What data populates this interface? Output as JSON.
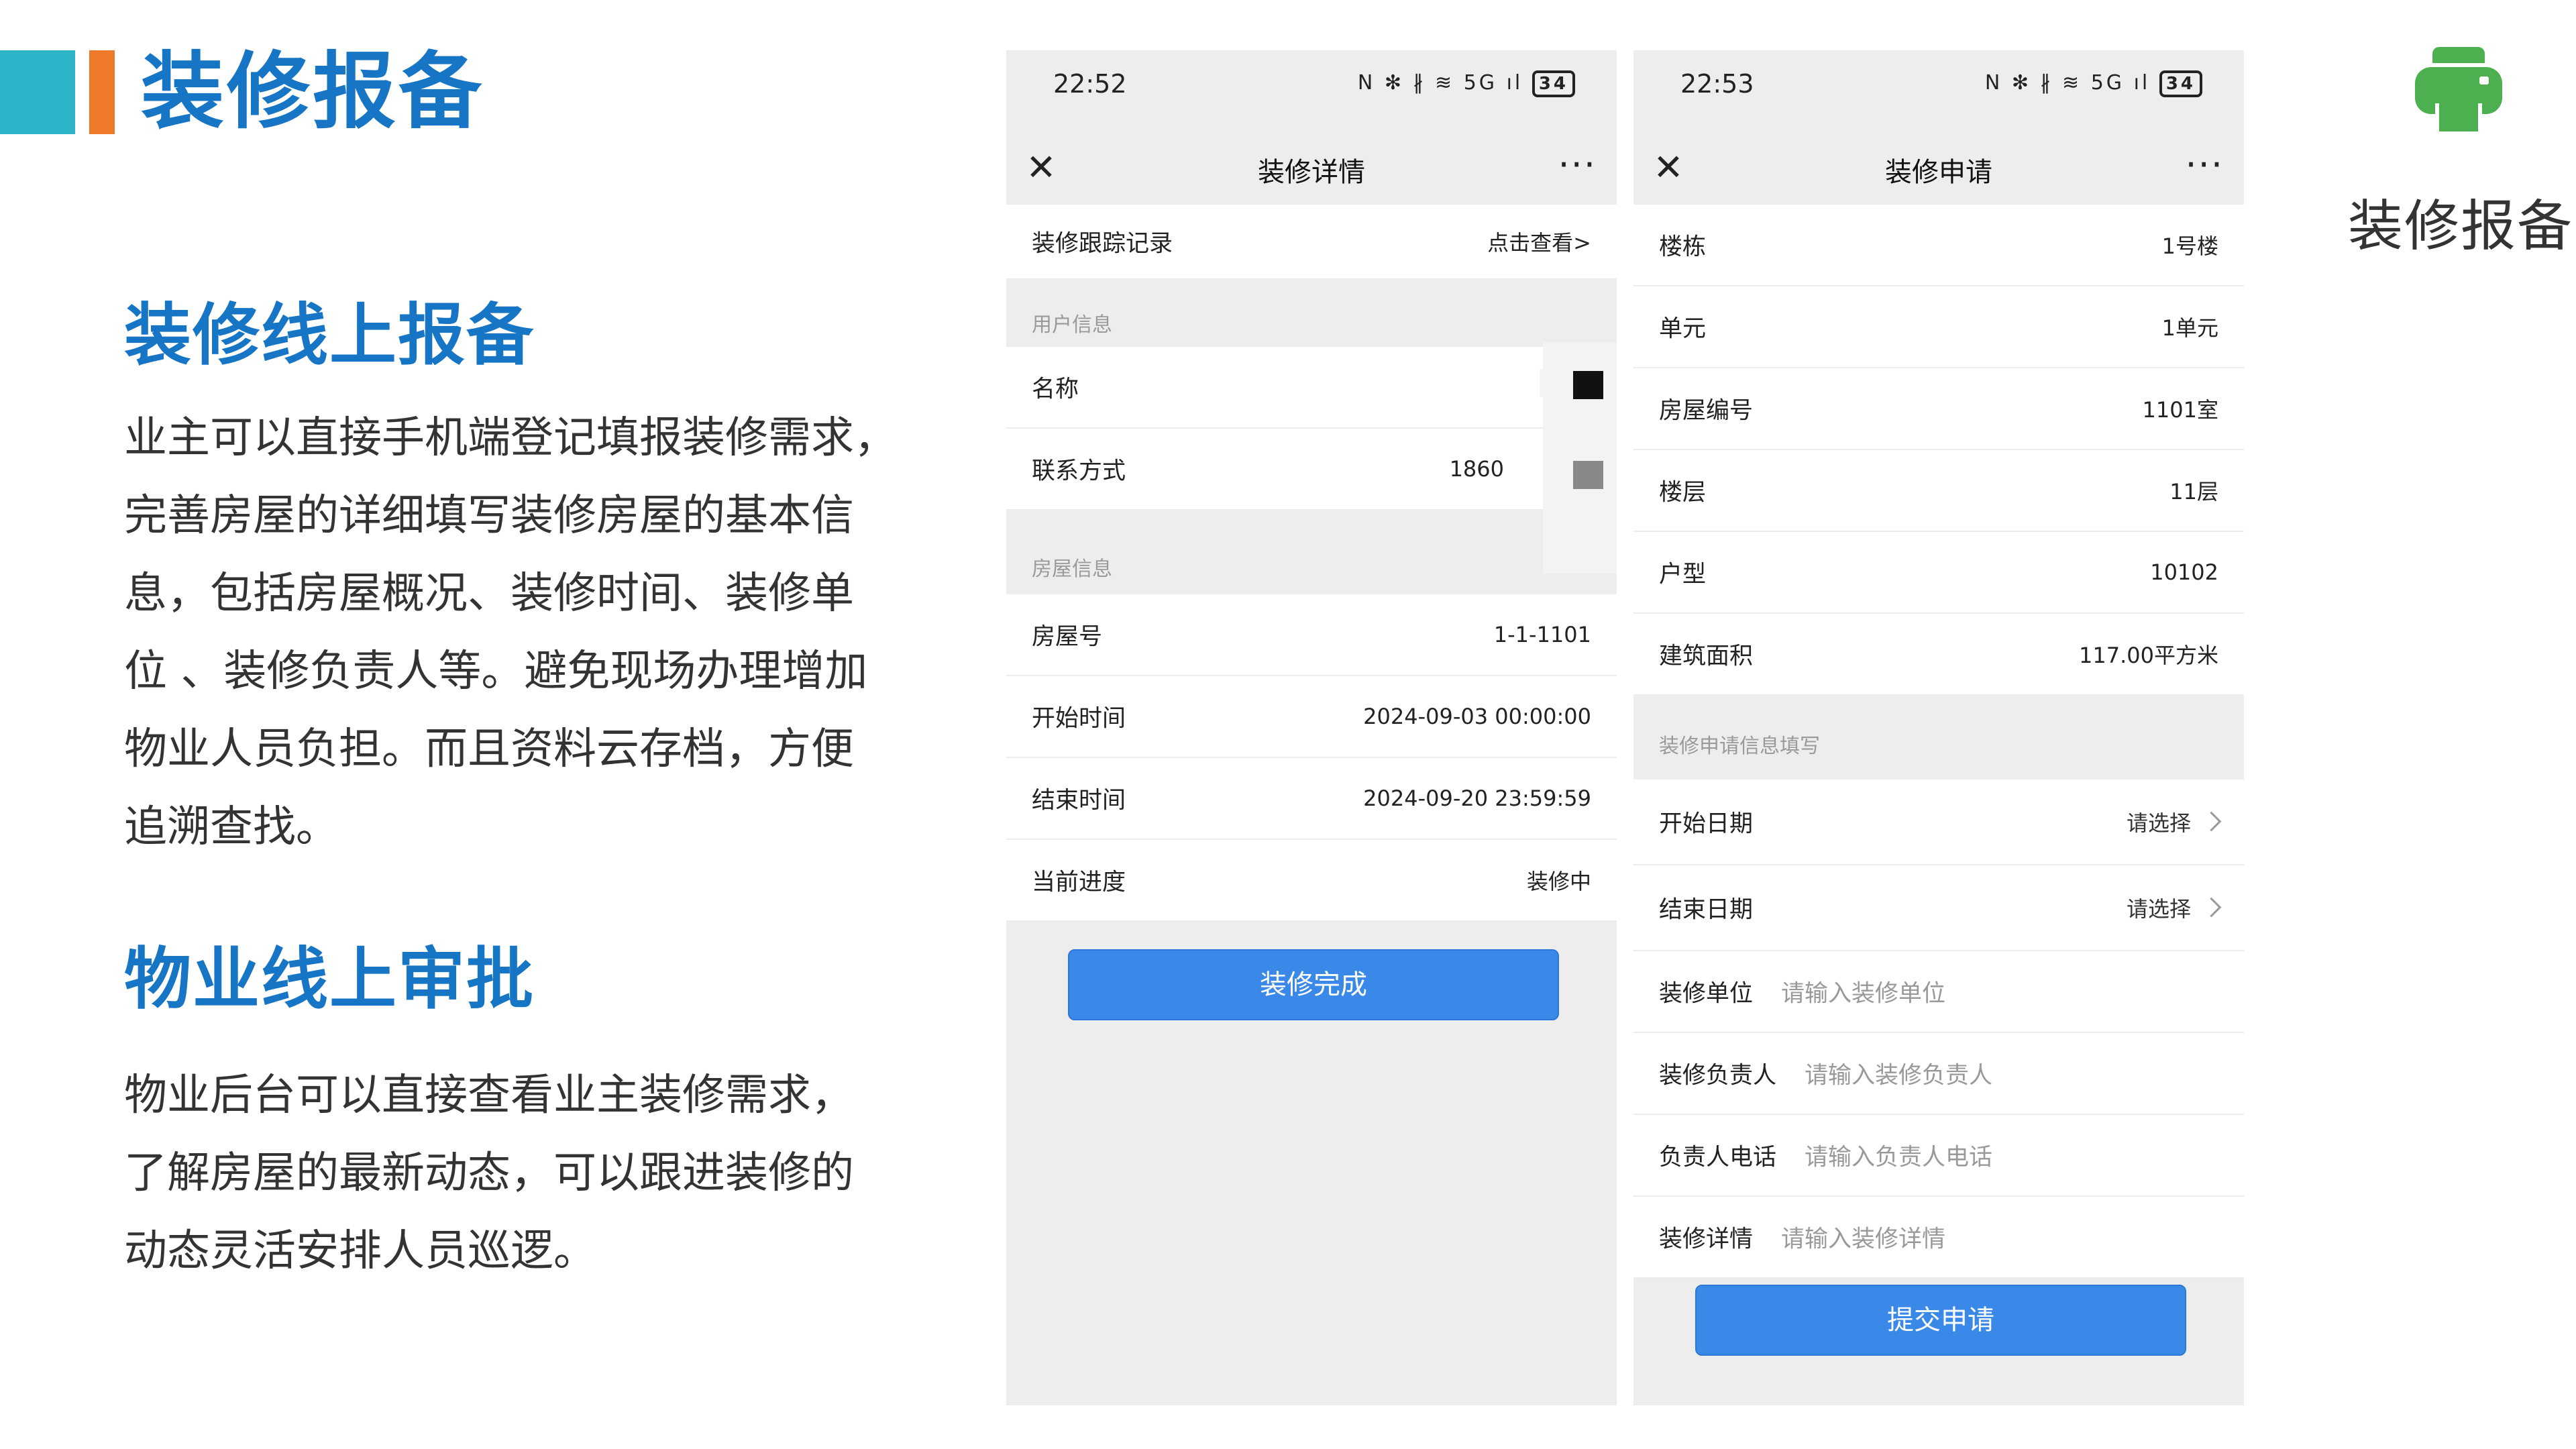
{
  "page_title": "装修报备",
  "section1": {
    "title": "装修线上报备",
    "lines": [
      "业主可以直接手机端登记填报装修需求，",
      "完善房屋的详细填写装修房屋的基本信",
      "息，包括房屋概况、装修时间、装修单",
      "位 、装修负责人等。避免现场办理增加",
      "物业人员负担。而且资料云存档，方便",
      "追溯查找。"
    ]
  },
  "section2": {
    "title": "物业线上审批",
    "lines": [
      "物业后台可以直接查看业主装修需求，",
      "了解房屋的最新动态，可以跟进装修的",
      "动态灵活安排人员巡逻。"
    ]
  },
  "phone1": {
    "status_time": "22:52",
    "status_icons": "N ✻ ∦ ≋ 5G ıl",
    "battery": "34",
    "nav_close": "✕",
    "nav_title": "装修详情",
    "nav_more": "···",
    "track_label": "装修跟踪记录",
    "track_value": "点击查看>",
    "group_user": "用户信息",
    "name_label": "名称",
    "contact_label": "联系方式",
    "contact_value": "1860",
    "group_house": "房屋信息",
    "house_no_label": "房屋号",
    "house_no_value": "1-1-1101",
    "start_label": "开始时间",
    "start_value": "2024-09-03 00:00:00",
    "end_label": "结束时间",
    "end_value": "2024-09-20 23:59:59",
    "progress_label": "当前进度",
    "progress_value": "装修中",
    "complete_button": "装修完成"
  },
  "phone2": {
    "status_time": "22:53",
    "status_icons": "N ✻ ∦ ≋ 5G ıl",
    "battery": "34",
    "nav_close": "✕",
    "nav_title": "装修申请",
    "nav_more": "···",
    "rows": [
      {
        "label": "楼栋",
        "value": "1号楼"
      },
      {
        "label": "单元",
        "value": "1单元"
      },
      {
        "label": "房屋编号",
        "value": "1101室"
      },
      {
        "label": "楼层",
        "value": "11层"
      },
      {
        "label": "户型",
        "value": "10102"
      },
      {
        "label": "建筑面积",
        "value": "117.00平方米"
      }
    ],
    "group_apply": "装修申请信息填写",
    "start_date_label": "开始日期",
    "end_date_label": "结束日期",
    "select_placeholder": "请选择",
    "unit_label": "装修单位",
    "unit_placeholder": "请输入装修单位",
    "manager_label": "装修负责人",
    "manager_placeholder": "请输入装修负责人",
    "phone_label": "负责人电话",
    "phone_placeholder": "请输入负责人电话",
    "detail_label": "装修详情",
    "detail_placeholder": "请输入装修详情",
    "submit_button": "提交申请"
  },
  "icon_label": "装修报备",
  "colors": {
    "title_blue": "#1775c5",
    "accent_teal": "#2bb3c8",
    "accent_orange": "#f07a2c",
    "button_blue": "#3a89e9",
    "icon_green": "#4caf50"
  }
}
